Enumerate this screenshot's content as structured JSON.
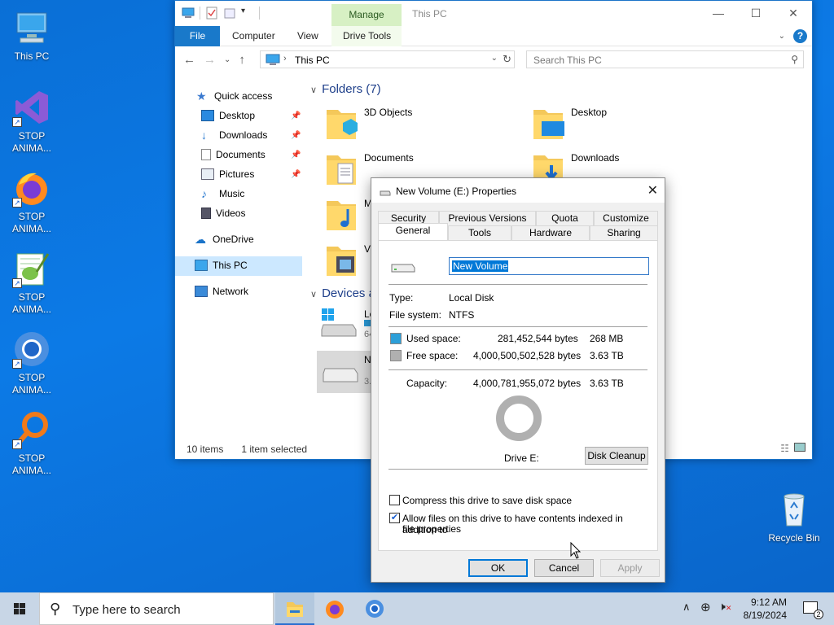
{
  "desktop": {
    "icons": [
      {
        "label": "This PC"
      },
      {
        "label": "STOP ANIMA..."
      },
      {
        "label": "STOP ANIMA..."
      },
      {
        "label": "STOP ANIMA..."
      },
      {
        "label": "STOP ANIMA..."
      },
      {
        "label": "STOP ANIMA..."
      }
    ],
    "recycle_bin": {
      "label": "Recycle Bin"
    }
  },
  "explorer": {
    "title": "This PC",
    "manage_tab": "Manage",
    "ribbon_tabs": {
      "file": "File",
      "computer": "Computer",
      "view": "View",
      "drive_tools": "Drive Tools"
    },
    "address": "This PC",
    "search_placeholder": "Search This PC",
    "nav": {
      "quick_access": "Quick access",
      "desktop": "Desktop",
      "downloads": "Downloads",
      "documents": "Documents",
      "pictures": "Pictures",
      "music": "Music",
      "videos": "Videos",
      "onedrive": "OneDrive",
      "this_pc": "This PC",
      "network": "Network"
    },
    "folders_header": "Folders (7)",
    "folders": {
      "objects": "3D Objects",
      "desktop": "Desktop",
      "documents": "Documents",
      "downloads": "Downloads",
      "music_partial": "M",
      "videos_partial": "Vi"
    },
    "devices_header": "Devices a",
    "drives": {
      "local_partial": "Lo",
      "local_size_partial": "64",
      "new_partial": "Ne",
      "new_size_partial": "3.6"
    },
    "status": {
      "items": "10 items",
      "selected": "1 item selected"
    }
  },
  "dialog": {
    "title": "New Volume (E:) Properties",
    "tabs_top": [
      "Security",
      "Previous Versions",
      "Quota",
      "Customize"
    ],
    "tabs_bottom": [
      "General",
      "Tools",
      "Hardware",
      "Sharing"
    ],
    "volume_name": "New Volume",
    "type_label": "Type:",
    "type_value": "Local Disk",
    "fs_label": "File system:",
    "fs_value": "NTFS",
    "used_label": "Used space:",
    "used_bytes": "281,452,544 bytes",
    "used_human": "268 MB",
    "free_label": "Free space:",
    "free_bytes": "4,000,500,502,528 bytes",
    "free_human": "3.63 TB",
    "capacity_label": "Capacity:",
    "capacity_bytes": "4,000,781,955,072 bytes",
    "capacity_human": "3.63 TB",
    "drive_label": "Drive E:",
    "cleanup": "Disk Cleanup",
    "compress": "Compress this drive to save disk space",
    "compress_checked": false,
    "index": "Allow files on this drive to have contents indexed in addition to",
    "index_2": "file properties",
    "index_checked": true,
    "ok": "OK",
    "cancel": "Cancel",
    "apply": "Apply",
    "used_color": "#2d9fd8",
    "free_color": "#b0b0b0"
  },
  "taskbar": {
    "search_placeholder": "Type here to search",
    "time": "9:12 AM",
    "date": "8/19/2024",
    "notifications": "2"
  }
}
